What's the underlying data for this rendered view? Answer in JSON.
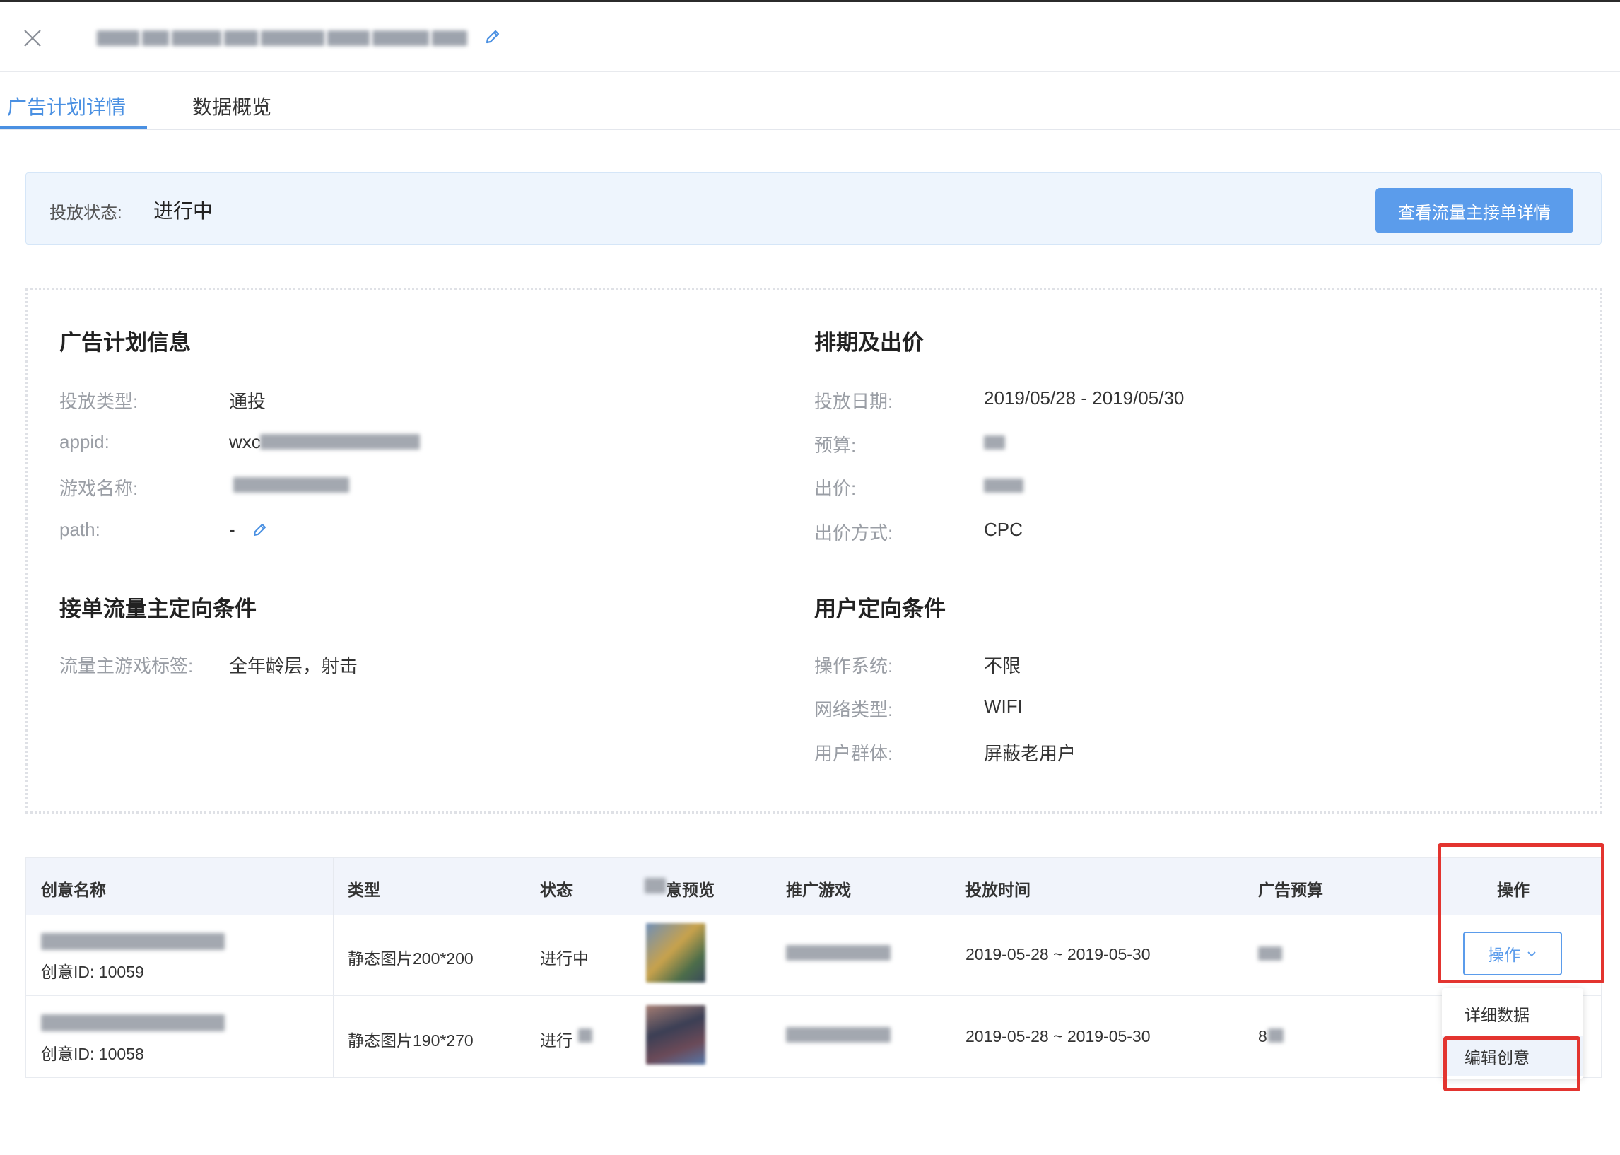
{
  "header": {
    "tabs": [
      {
        "label": "广告计划详情",
        "active": true
      },
      {
        "label": "数据概览",
        "active": false
      }
    ]
  },
  "status": {
    "label": "投放状态:",
    "value": "进行中",
    "button_label": "查看流量主接单详情"
  },
  "plan_info": {
    "title": "广告计划信息",
    "fields": [
      {
        "label": "投放类型:",
        "value": "通投"
      },
      {
        "label": "appid:",
        "value": "wxc"
      },
      {
        "label": "游戏名称:",
        "value": ""
      },
      {
        "label": "path:",
        "value": "-"
      }
    ]
  },
  "schedule": {
    "title": "排期及出价",
    "fields": [
      {
        "label": "投放日期:",
        "value": "2019/05/28 - 2019/05/30"
      },
      {
        "label": "预算:",
        "value": ""
      },
      {
        "label": "出价:",
        "value": ""
      },
      {
        "label": "出价方式:",
        "value": "CPC"
      }
    ]
  },
  "traffic_targeting": {
    "title": "接单流量主定向条件",
    "fields": [
      {
        "label": "流量主游戏标签:",
        "value": "全年龄层，射击"
      }
    ]
  },
  "user_targeting": {
    "title": "用户定向条件",
    "fields": [
      {
        "label": "操作系统:",
        "value": "不限"
      },
      {
        "label": "网络类型:",
        "value": "WIFI"
      },
      {
        "label": "用户群体:",
        "value": "屏蔽老用户"
      }
    ]
  },
  "table": {
    "headers": [
      "创意名称",
      "类型",
      "状态",
      "意预览",
      "推广游戏",
      "投放时间",
      "广告预算",
      "操作"
    ],
    "rows": [
      {
        "creative_id": "创意ID:  10059",
        "type": "静态图片200*200",
        "status": "进行中",
        "time": "2019-05-28 ~ 2019-05-30",
        "budget": ""
      },
      {
        "creative_id": "创意ID:  10058",
        "type": "静态图片190*270",
        "status": "进行",
        "time": "2019-05-28 ~ 2019-05-30",
        "budget": "8"
      }
    ],
    "op_button_label": "操作"
  },
  "dropdown": {
    "items": [
      "详细数据",
      "编辑创意"
    ]
  },
  "colors": {
    "accent": "#4a90e2",
    "button": "#5b9ceb",
    "annotation": "#e3342f"
  }
}
